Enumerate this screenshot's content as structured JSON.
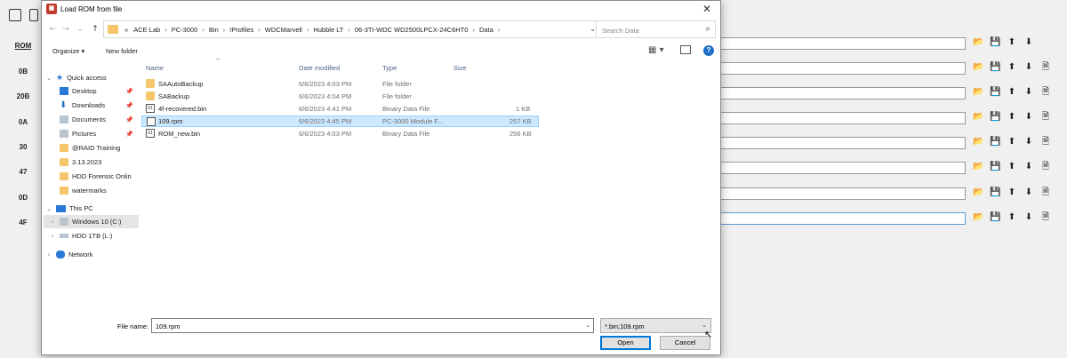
{
  "dialog": {
    "title": "Load ROM from file",
    "close_glyph": "✕"
  },
  "nav": {
    "back": "←",
    "forward": "→",
    "dropdown": "⌄",
    "up": "↑",
    "breadcrumbs": [
      "«",
      "ACE Lab",
      "PC-3000",
      "Bin",
      "!Profiles",
      "WDCMarvell",
      "Hubble LT",
      "06-3TI-WDC WD2500LPCX-24C6HT0",
      "Data"
    ],
    "separator": "›",
    "refresh": "↻",
    "search_placeholder": "Search Data"
  },
  "toolbar": {
    "organize": "Organize ▾",
    "new_folder": "New folder",
    "view_glyph": "▦ ▾",
    "help": "?"
  },
  "sidebar": {
    "quick_access": "Quick access",
    "items": [
      {
        "label": "Desktop",
        "icon": "desktop-icon",
        "pinned": true
      },
      {
        "label": "Downloads",
        "icon": "downloads-icon",
        "pinned": true
      },
      {
        "label": "Documents",
        "icon": "documents-icon",
        "pinned": true
      },
      {
        "label": "Pictures",
        "icon": "pictures-icon",
        "pinned": true
      },
      {
        "label": "@RAID Training",
        "icon": "folder-icon",
        "pinned": false
      },
      {
        "label": "3.13.2023",
        "icon": "folder-icon",
        "pinned": false
      },
      {
        "label": "HDD Forensic Onlin",
        "icon": "folder-icon",
        "pinned": false
      },
      {
        "label": "watermarks",
        "icon": "folder-icon",
        "pinned": false
      }
    ],
    "this_pc": "This PC",
    "drives": [
      "Windows 10 (C:)",
      "HDD 1TB (L:)"
    ],
    "network": "Network",
    "pin_glyph": "📌"
  },
  "columns": [
    "Name",
    "Date modified",
    "Type",
    "Size"
  ],
  "files": [
    {
      "name": "SAAutoBackup",
      "date": "6/6/2023 4:03 PM",
      "type": "File folder",
      "size": "",
      "kind": "folder"
    },
    {
      "name": "SABackup",
      "date": "6/6/2023 4:04 PM",
      "type": "File folder",
      "size": "",
      "kind": "folder"
    },
    {
      "name": "4f-recovered.bin",
      "date": "6/6/2023 4:41 PM",
      "type": "Binary Data File",
      "size": "1 KB",
      "kind": "bin"
    },
    {
      "name": "109.rpm",
      "date": "6/6/2023 4:45 PM",
      "type": "PC-3000 Module F...",
      "size": "257 KB",
      "kind": "rpm"
    },
    {
      "name": "ROM_new.bin",
      "date": "6/6/2023 4:03 PM",
      "type": "Binary Data File",
      "size": "256 KB",
      "kind": "bin"
    }
  ],
  "bottom": {
    "filename_label": "File name:",
    "filename_value": "109.rpm",
    "filter_value": "*.bin;109.rpm",
    "open": "Open",
    "cancel": "Cancel"
  },
  "background": {
    "labels": [
      "ROM",
      "0B",
      "20B",
      "0A",
      "30",
      "47",
      "0D",
      "4F"
    ],
    "row_icons": [
      "📂",
      "💾",
      "⬆",
      "⬇",
      "🗎"
    ]
  },
  "colors": {
    "selection": "#cce8ff",
    "accent": "#0078d7",
    "folder": "#f5c76a"
  }
}
